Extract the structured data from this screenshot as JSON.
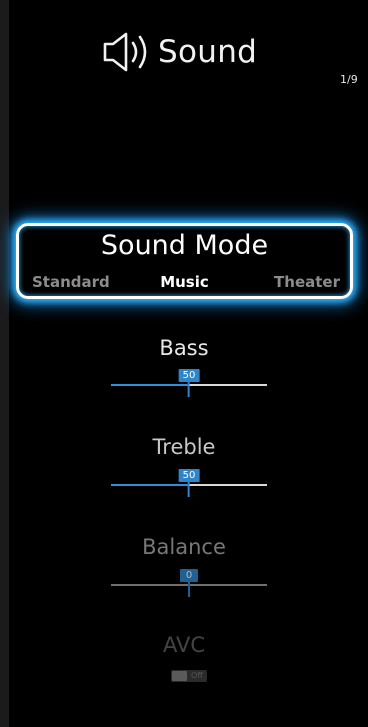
{
  "header": {
    "title": "Sound",
    "icon": "speaker-sound-icon",
    "page_indicator": "1/9"
  },
  "sound_mode": {
    "label": "Sound Mode",
    "options": [
      "Standard",
      "Music",
      "Theater"
    ],
    "selected": "Music"
  },
  "settings": {
    "bass": {
      "label": "Bass",
      "value": "50",
      "level": 0.5
    },
    "treble": {
      "label": "Treble",
      "value": "50",
      "level": 0.5
    },
    "balance": {
      "label": "Balance",
      "value": "0",
      "level": 0.5
    },
    "avc": {
      "label": "AVC",
      "state": "Off"
    }
  },
  "colors": {
    "accent": "#2e86c9",
    "glow": "#33b5ff",
    "background": "#000000"
  }
}
